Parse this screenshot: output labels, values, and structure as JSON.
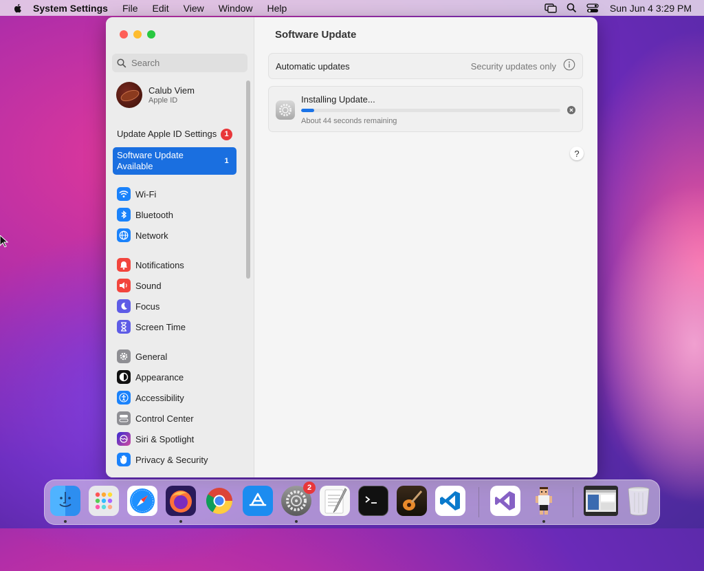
{
  "menubar": {
    "app_name": "System Settings",
    "menus": [
      "File",
      "Edit",
      "View",
      "Window",
      "Help"
    ],
    "clock": "Sun Jun 4  3:29 PM"
  },
  "sidebar": {
    "search_placeholder": "Search",
    "profile": {
      "name": "Calub Viem",
      "subtitle": "Apple ID"
    },
    "notices": [
      {
        "label": "Update Apple ID Settings",
        "badge": "1"
      },
      {
        "label": "Software Update Available",
        "badge": "1"
      }
    ],
    "items": [
      {
        "label": "Wi-Fi",
        "icon": "wifi-icon",
        "color": "#1a82fb"
      },
      {
        "label": "Bluetooth",
        "icon": "bluetooth-icon",
        "color": "#1a82fb"
      },
      {
        "label": "Network",
        "icon": "globe-icon",
        "color": "#1a82fb"
      },
      {
        "label": "Notifications",
        "icon": "bell-icon",
        "color": "#f2453d"
      },
      {
        "label": "Sound",
        "icon": "speaker-icon",
        "color": "#f2453d"
      },
      {
        "label": "Focus",
        "icon": "moon-icon",
        "color": "#5e5ce6"
      },
      {
        "label": "Screen Time",
        "icon": "hourglass-icon",
        "color": "#5e5ce6"
      },
      {
        "label": "General",
        "icon": "gear-icon",
        "color": "#8e8e93"
      },
      {
        "label": "Appearance",
        "icon": "appearance-icon",
        "color": "#111111"
      },
      {
        "label": "Accessibility",
        "icon": "accessibility-icon",
        "color": "#1a82fb"
      },
      {
        "label": "Control Center",
        "icon": "toggles-icon",
        "color": "#8e8e93"
      },
      {
        "label": "Siri & Spotlight",
        "icon": "siri-icon",
        "color": "#b04ae0"
      },
      {
        "label": "Privacy & Security",
        "icon": "hand-icon",
        "color": "#1a82fb"
      }
    ]
  },
  "main": {
    "title": "Software Update",
    "automatic": {
      "label": "Automatic updates",
      "value": "Security updates only"
    },
    "install": {
      "title": "Installing Update...",
      "remaining": "About 44 seconds remaining",
      "progress": 0.05
    },
    "help": "?"
  },
  "dock": {
    "settings_badge": "2"
  }
}
